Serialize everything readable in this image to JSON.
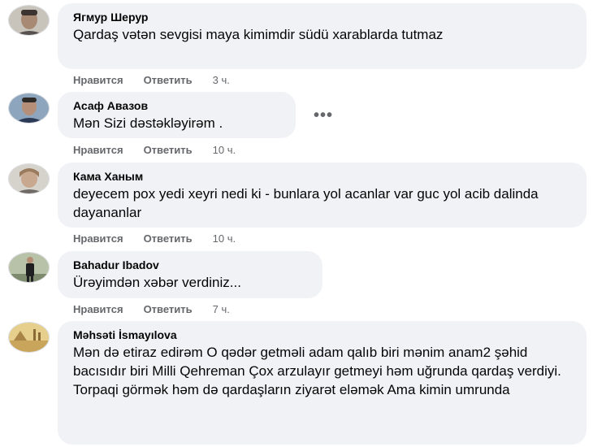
{
  "comments": [
    {
      "author": "Ягмур Шерур",
      "text": "Qardaş vətən sevgisi maya kimimdir südü xarablarda tutmaz",
      "like": "Нравится",
      "reply": "Ответить",
      "time": "3 ч.",
      "avatar_icon": "man-portrait"
    },
    {
      "author": "Асаф Авазов",
      "text": "Mən Sizi dəstəkləyirəm .",
      "like": "Нравится",
      "reply": "Ответить",
      "time": "10 ч.",
      "avatar_icon": "man-portrait"
    },
    {
      "author": "Кама Ханым",
      "text": "deyecem pox yedi xeyri nedi ki - bunlara yol acanlar var guc yol acib dalinda dayananlar",
      "like": "Нравится",
      "reply": "Ответить",
      "time": "10 ч.",
      "avatar_icon": "woman-portrait"
    },
    {
      "author": "Bahadur Ibadov",
      "text": "Ürəyimdən xəbər verdiniz...",
      "like": "Нравится",
      "reply": "Ответить",
      "time": "7 ч.",
      "avatar_icon": "man-standing-photo"
    },
    {
      "author": "Məhsəti İsmayılova",
      "text": "Mən də etiraz edirəm O qədər getməli adam qalıb biri mənim anam2 şəhid bacısıdır biri Milli Qehreman Çox arzulayır getmeyi həm uğrunda qardaş verdiyi. Torpaqi görmək həm də qardaşların ziyarət eləmək Ama kimin umrunda",
      "avatar_icon": "landscape-photo"
    }
  ],
  "more_options": "•••"
}
